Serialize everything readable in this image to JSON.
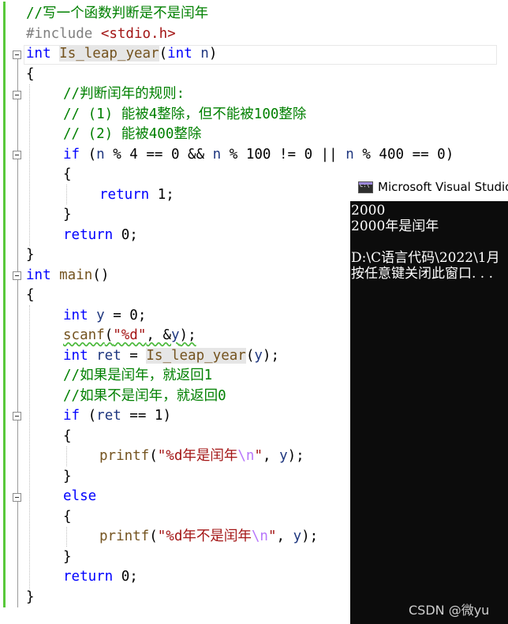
{
  "code": {
    "l1": "//写一个函数判断是不是闰年",
    "l2_pp": "#include ",
    "l2_hdr": "<stdio.h>",
    "l3_kw": "int",
    "l3_fn": "Is_leap_year",
    "l3_open": "(",
    "l3_kw2": "int",
    "l3_param": "n",
    "l3_close": ")",
    "brace_open": "{",
    "brace_close": "}",
    "l5": "//判断闰年的规则:",
    "l6": "// (1) 能被4整除，但不能被100整除",
    "l7": "// (2) 能被400整除",
    "l8_if": "if",
    "l8_a": " (",
    "l8_n1": "n",
    "l8_b": " % 4 == 0 && ",
    "l8_n2": "n",
    "l8_c": " % 100 != 0 || ",
    "l8_n3": "n",
    "l8_d": " % 400 == 0)",
    "l10_ret": "return",
    "l10_val": " 1;",
    "l12_ret": "return",
    "l12_val": " 0;",
    "l14_kw": "int",
    "l14_fn": " main",
    "l14_rest": "()",
    "l16_kw": "int",
    "l16_id": " y",
    "l16_rest": " = 0;",
    "l17_fn": "scanf",
    "l17_a": "(",
    "l17_str": "\"%d\"",
    "l17_b": ", &",
    "l17_id": "y",
    "l17_c": ");",
    "l18_kw": "int",
    "l18_id": " ret",
    "l18_a": " = ",
    "l18_fn": "Is_leap_year",
    "l18_b": "(",
    "l18_y": "y",
    "l18_c": ");",
    "l19": "//如果是闰年，就返回1",
    "l20": "//如果不是闰年，就返回0",
    "l21_if": "if",
    "l21_a": " (",
    "l21_id": "ret",
    "l21_b": " == 1)",
    "l23_fn": "printf",
    "l23_a": "(",
    "l23_str": "\"%d年是闰年",
    "l23_esc": "\\n",
    "l23_q": "\"",
    "l23_b": ", ",
    "l23_y": "y",
    "l23_c": ");",
    "l25_else": "else",
    "l27_fn": "printf",
    "l27_a": "(",
    "l27_str": "\"%d年不是闰年",
    "l27_esc": "\\n",
    "l27_q": "\"",
    "l27_b": ", ",
    "l27_y": "y",
    "l27_c": ");",
    "l29_ret": "return",
    "l29_val": " 0;"
  },
  "console": {
    "title": "Microsoft Visual Studio",
    "line1": "2000",
    "line2": "2000年是闰年",
    "line3": "D:\\C语言代码\\2022\\1月",
    "line4": "按任意键关闭此窗口. . ."
  },
  "watermark": "CSDN @微yu",
  "colors": {
    "keyword": "#0000ff",
    "comment": "#008000",
    "string": "#a31515",
    "function": "#74531f",
    "identifier": "#1f377f",
    "change_bar": "#58c83a",
    "console_bg": "#0c0c0c"
  }
}
